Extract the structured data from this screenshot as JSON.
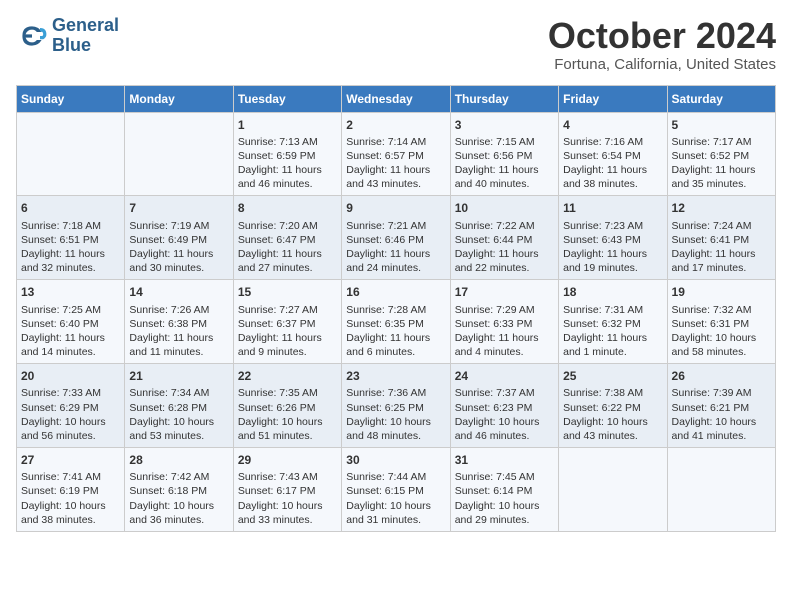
{
  "header": {
    "logo_line1": "General",
    "logo_line2": "Blue",
    "month_title": "October 2024",
    "location": "Fortuna, California, United States"
  },
  "days_of_week": [
    "Sunday",
    "Monday",
    "Tuesday",
    "Wednesday",
    "Thursday",
    "Friday",
    "Saturday"
  ],
  "weeks": [
    [
      {
        "day": "",
        "sunrise": "",
        "sunset": "",
        "daylight": ""
      },
      {
        "day": "",
        "sunrise": "",
        "sunset": "",
        "daylight": ""
      },
      {
        "day": "1",
        "sunrise": "Sunrise: 7:13 AM",
        "sunset": "Sunset: 6:59 PM",
        "daylight": "Daylight: 11 hours and 46 minutes."
      },
      {
        "day": "2",
        "sunrise": "Sunrise: 7:14 AM",
        "sunset": "Sunset: 6:57 PM",
        "daylight": "Daylight: 11 hours and 43 minutes."
      },
      {
        "day": "3",
        "sunrise": "Sunrise: 7:15 AM",
        "sunset": "Sunset: 6:56 PM",
        "daylight": "Daylight: 11 hours and 40 minutes."
      },
      {
        "day": "4",
        "sunrise": "Sunrise: 7:16 AM",
        "sunset": "Sunset: 6:54 PM",
        "daylight": "Daylight: 11 hours and 38 minutes."
      },
      {
        "day": "5",
        "sunrise": "Sunrise: 7:17 AM",
        "sunset": "Sunset: 6:52 PM",
        "daylight": "Daylight: 11 hours and 35 minutes."
      }
    ],
    [
      {
        "day": "6",
        "sunrise": "Sunrise: 7:18 AM",
        "sunset": "Sunset: 6:51 PM",
        "daylight": "Daylight: 11 hours and 32 minutes."
      },
      {
        "day": "7",
        "sunrise": "Sunrise: 7:19 AM",
        "sunset": "Sunset: 6:49 PM",
        "daylight": "Daylight: 11 hours and 30 minutes."
      },
      {
        "day": "8",
        "sunrise": "Sunrise: 7:20 AM",
        "sunset": "Sunset: 6:47 PM",
        "daylight": "Daylight: 11 hours and 27 minutes."
      },
      {
        "day": "9",
        "sunrise": "Sunrise: 7:21 AM",
        "sunset": "Sunset: 6:46 PM",
        "daylight": "Daylight: 11 hours and 24 minutes."
      },
      {
        "day": "10",
        "sunrise": "Sunrise: 7:22 AM",
        "sunset": "Sunset: 6:44 PM",
        "daylight": "Daylight: 11 hours and 22 minutes."
      },
      {
        "day": "11",
        "sunrise": "Sunrise: 7:23 AM",
        "sunset": "Sunset: 6:43 PM",
        "daylight": "Daylight: 11 hours and 19 minutes."
      },
      {
        "day": "12",
        "sunrise": "Sunrise: 7:24 AM",
        "sunset": "Sunset: 6:41 PM",
        "daylight": "Daylight: 11 hours and 17 minutes."
      }
    ],
    [
      {
        "day": "13",
        "sunrise": "Sunrise: 7:25 AM",
        "sunset": "Sunset: 6:40 PM",
        "daylight": "Daylight: 11 hours and 14 minutes."
      },
      {
        "day": "14",
        "sunrise": "Sunrise: 7:26 AM",
        "sunset": "Sunset: 6:38 PM",
        "daylight": "Daylight: 11 hours and 11 minutes."
      },
      {
        "day": "15",
        "sunrise": "Sunrise: 7:27 AM",
        "sunset": "Sunset: 6:37 PM",
        "daylight": "Daylight: 11 hours and 9 minutes."
      },
      {
        "day": "16",
        "sunrise": "Sunrise: 7:28 AM",
        "sunset": "Sunset: 6:35 PM",
        "daylight": "Daylight: 11 hours and 6 minutes."
      },
      {
        "day": "17",
        "sunrise": "Sunrise: 7:29 AM",
        "sunset": "Sunset: 6:33 PM",
        "daylight": "Daylight: 11 hours and 4 minutes."
      },
      {
        "day": "18",
        "sunrise": "Sunrise: 7:31 AM",
        "sunset": "Sunset: 6:32 PM",
        "daylight": "Daylight: 11 hours and 1 minute."
      },
      {
        "day": "19",
        "sunrise": "Sunrise: 7:32 AM",
        "sunset": "Sunset: 6:31 PM",
        "daylight": "Daylight: 10 hours and 58 minutes."
      }
    ],
    [
      {
        "day": "20",
        "sunrise": "Sunrise: 7:33 AM",
        "sunset": "Sunset: 6:29 PM",
        "daylight": "Daylight: 10 hours and 56 minutes."
      },
      {
        "day": "21",
        "sunrise": "Sunrise: 7:34 AM",
        "sunset": "Sunset: 6:28 PM",
        "daylight": "Daylight: 10 hours and 53 minutes."
      },
      {
        "day": "22",
        "sunrise": "Sunrise: 7:35 AM",
        "sunset": "Sunset: 6:26 PM",
        "daylight": "Daylight: 10 hours and 51 minutes."
      },
      {
        "day": "23",
        "sunrise": "Sunrise: 7:36 AM",
        "sunset": "Sunset: 6:25 PM",
        "daylight": "Daylight: 10 hours and 48 minutes."
      },
      {
        "day": "24",
        "sunrise": "Sunrise: 7:37 AM",
        "sunset": "Sunset: 6:23 PM",
        "daylight": "Daylight: 10 hours and 46 minutes."
      },
      {
        "day": "25",
        "sunrise": "Sunrise: 7:38 AM",
        "sunset": "Sunset: 6:22 PM",
        "daylight": "Daylight: 10 hours and 43 minutes."
      },
      {
        "day": "26",
        "sunrise": "Sunrise: 7:39 AM",
        "sunset": "Sunset: 6:21 PM",
        "daylight": "Daylight: 10 hours and 41 minutes."
      }
    ],
    [
      {
        "day": "27",
        "sunrise": "Sunrise: 7:41 AM",
        "sunset": "Sunset: 6:19 PM",
        "daylight": "Daylight: 10 hours and 38 minutes."
      },
      {
        "day": "28",
        "sunrise": "Sunrise: 7:42 AM",
        "sunset": "Sunset: 6:18 PM",
        "daylight": "Daylight: 10 hours and 36 minutes."
      },
      {
        "day": "29",
        "sunrise": "Sunrise: 7:43 AM",
        "sunset": "Sunset: 6:17 PM",
        "daylight": "Daylight: 10 hours and 33 minutes."
      },
      {
        "day": "30",
        "sunrise": "Sunrise: 7:44 AM",
        "sunset": "Sunset: 6:15 PM",
        "daylight": "Daylight: 10 hours and 31 minutes."
      },
      {
        "day": "31",
        "sunrise": "Sunrise: 7:45 AM",
        "sunset": "Sunset: 6:14 PM",
        "daylight": "Daylight: 10 hours and 29 minutes."
      },
      {
        "day": "",
        "sunrise": "",
        "sunset": "",
        "daylight": ""
      },
      {
        "day": "",
        "sunrise": "",
        "sunset": "",
        "daylight": ""
      }
    ]
  ]
}
